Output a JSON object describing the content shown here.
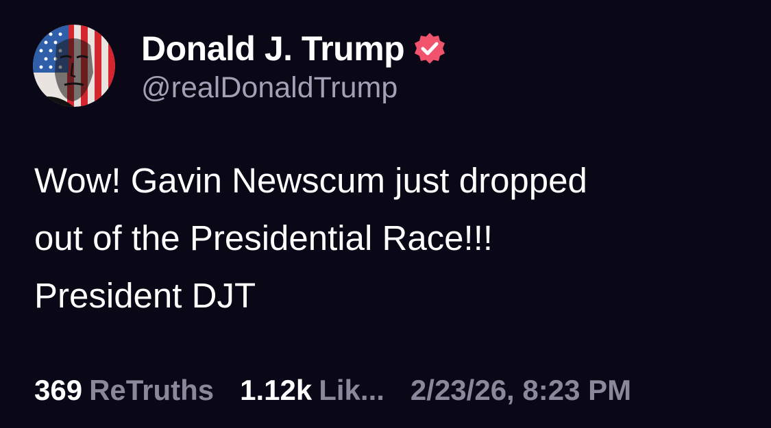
{
  "author": {
    "display_name": "Donald J. Trump",
    "handle": "@realDonaldTrump",
    "verified_icon": "verified-badge-icon",
    "verified_color": "#f2536c"
  },
  "post": {
    "lines": [
      "Wow! Gavin Newscum just dropped",
      "out of the Presidential Race!!!",
      "President DJT"
    ]
  },
  "stats": {
    "retruths_count": "369",
    "retruths_label": "ReTruths",
    "likes_count": "1.12k",
    "likes_label": "Lik...",
    "timestamp": "2/23/26, 8:23 PM"
  },
  "colors": {
    "background": "#0a0717",
    "secondary_text": "#8c889b"
  }
}
